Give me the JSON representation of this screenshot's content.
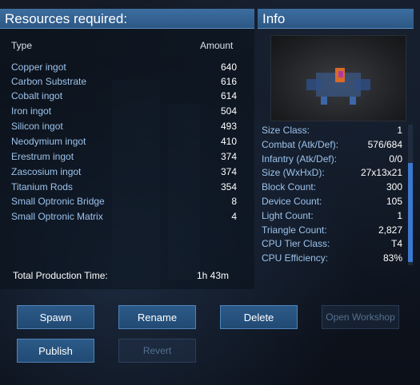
{
  "resources": {
    "title": "Resources required:",
    "col_type": "Type",
    "col_amount": "Amount",
    "items": [
      {
        "name": "Copper ingot",
        "amount": "640"
      },
      {
        "name": "Carbon Substrate",
        "amount": "616"
      },
      {
        "name": "Cobalt ingot",
        "amount": "614"
      },
      {
        "name": "Iron ingot",
        "amount": "504"
      },
      {
        "name": "Silicon ingot",
        "amount": "493"
      },
      {
        "name": "Neodymium ingot",
        "amount": "410"
      },
      {
        "name": "Erestrum ingot",
        "amount": "374"
      },
      {
        "name": "Zascosium ingot",
        "amount": "374"
      },
      {
        "name": "Titanium Rods",
        "amount": "354"
      },
      {
        "name": "Small Optronic Bridge",
        "amount": "8"
      },
      {
        "name": "Small Optronic Matrix",
        "amount": "4"
      }
    ],
    "total_label": "Total Production Time:",
    "total_value": "1h 43m"
  },
  "info": {
    "title": "Info",
    "rows": [
      {
        "label": "Size Class:",
        "value": "1"
      },
      {
        "label": "Combat (Atk/Def):",
        "value": "576/684"
      },
      {
        "label": "Infantry (Atk/Def):",
        "value": "0/0"
      },
      {
        "label": "Size (WxHxD):",
        "value": "27x13x21"
      },
      {
        "label": "Block Count:",
        "value": "300"
      },
      {
        "label": "Device Count:",
        "value": "105"
      },
      {
        "label": "Light Count:",
        "value": "1"
      },
      {
        "label": "Triangle Count:",
        "value": "2,827"
      },
      {
        "label": "CPU Tier Class:",
        "value": "T4"
      },
      {
        "label": "CPU Efficiency:",
        "value": "83%"
      }
    ]
  },
  "buttons": {
    "spawn": "Spawn",
    "rename": "Rename",
    "delete": "Delete",
    "open_workshop": "Open Workshop",
    "publish": "Publish",
    "revert": "Revert"
  },
  "colors": {
    "header_bg": "#2c5784",
    "label_color": "#9cc3ec",
    "accent_scroll": "#3b78d0"
  }
}
